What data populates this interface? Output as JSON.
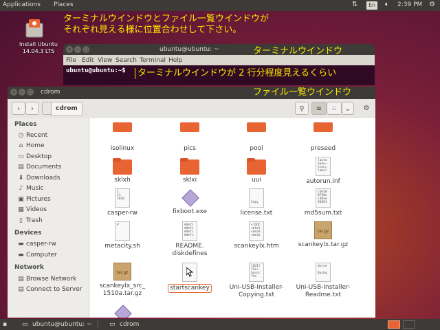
{
  "top_panel": {
    "menu": [
      "Applications",
      "Places"
    ],
    "keyboard_layout": "En",
    "clock": "2:39 PM"
  },
  "desktop": {
    "install_icon_label_line1": "Install Ubuntu",
    "install_icon_label_line2": "14.04.3 LTS"
  },
  "annotations": {
    "main_line1": "ターミナルウインドウとファイル一覧ウインドウが",
    "main_line2": "それぞれ見える様に位置合わせして下さい。",
    "terminal_label": "ターミナルウインドウ",
    "terminal_hint": "ターミナルウインドウが 2 行分程度見えるくらい",
    "filelist_label": "ファイル一覧ウインドウ"
  },
  "terminal": {
    "title": "ubuntu@ubuntu: ~",
    "menu": [
      "File",
      "Edit",
      "View",
      "Search",
      "Terminal",
      "Help"
    ],
    "prompt": "ubuntu@ubuntu:~$"
  },
  "file_manager": {
    "title": "cdrom",
    "breadcrumb": "cdrom",
    "sidebar": {
      "places_heading": "Places",
      "places": [
        {
          "label": "Recent",
          "icon": "clock-icon"
        },
        {
          "label": "Home",
          "icon": "home-icon"
        },
        {
          "label": "Desktop",
          "icon": "desktop-icon"
        },
        {
          "label": "Documents",
          "icon": "documents-icon"
        },
        {
          "label": "Downloads",
          "icon": "downloads-icon"
        },
        {
          "label": "Music",
          "icon": "music-icon"
        },
        {
          "label": "Pictures",
          "icon": "pictures-icon"
        },
        {
          "label": "Videos",
          "icon": "videos-icon"
        },
        {
          "label": "Trash",
          "icon": "trash-icon"
        }
      ],
      "devices_heading": "Devices",
      "devices": [
        {
          "label": "casper-rw",
          "icon": "drive-icon"
        },
        {
          "label": "Computer",
          "icon": "computer-icon"
        }
      ],
      "network_heading": "Network",
      "network": [
        {
          "label": "Browse Network",
          "icon": "network-icon"
        },
        {
          "label": "Connect to Server",
          "icon": "server-icon"
        }
      ]
    },
    "files": [
      {
        "name": "isolinux",
        "kind": "folder"
      },
      {
        "name": "pics",
        "kind": "folder"
      },
      {
        "name": "pool",
        "kind": "folder"
      },
      {
        "name": "preseed",
        "kind": "folder"
      },
      {
        "name": "sklxh",
        "kind": "folder"
      },
      {
        "name": "sklxi",
        "kind": "folder"
      },
      {
        "name": "uui",
        "kind": "folder"
      },
      {
        "name": "autorun.inf",
        "kind": "text",
        "preview": "[auto\nopen=\nicon=\nlabel"
      },
      {
        "name": "casper-rw",
        "kind": "binary",
        "preview": "1\n11\n1010"
      },
      {
        "name": "fixboot.exe",
        "kind": "exe"
      },
      {
        "name": "license.txt",
        "kind": "text",
        "preview": "\n\n\nCopy"
      },
      {
        "name": "md5sum.txt",
        "kind": "text",
        "preview": "cde50\n0738e\ncd8ae\n92091"
      },
      {
        "name": "metacity.sh",
        "kind": "script",
        "preview": "#\n\n\n"
      },
      {
        "name": "README.\ndiskdefines",
        "kind": "text",
        "preview": "#defi\n#defi\n#defi\n#defi"
      },
      {
        "name": "scankeylx.htm",
        "kind": "html",
        "preview": "<!DOC\n<html\n<head\n<meta"
      },
      {
        "name": "scankeylx.tar.gz",
        "kind": "archive",
        "badge": "tar.gz"
      },
      {
        "name": "scankeylx_src_\n1510a.tar.gz",
        "kind": "archive",
        "badge": "tar.gz"
      },
      {
        "name": "startscankey",
        "kind": "script",
        "preview": ""
      },
      {
        "name": "Uni-USB-Installer-\nCopying.txt",
        "kind": "text",
        "preview": "[UUI]\nThis\nSourc\nThe"
      },
      {
        "name": "Uni-USB-Installer-\nReadme.txt",
        "kind": "text",
        "preview": "Unive\n\nBackg\n"
      }
    ]
  },
  "taskbar": {
    "items": [
      "ubuntu@ubuntu: ~",
      "cdrom"
    ]
  }
}
